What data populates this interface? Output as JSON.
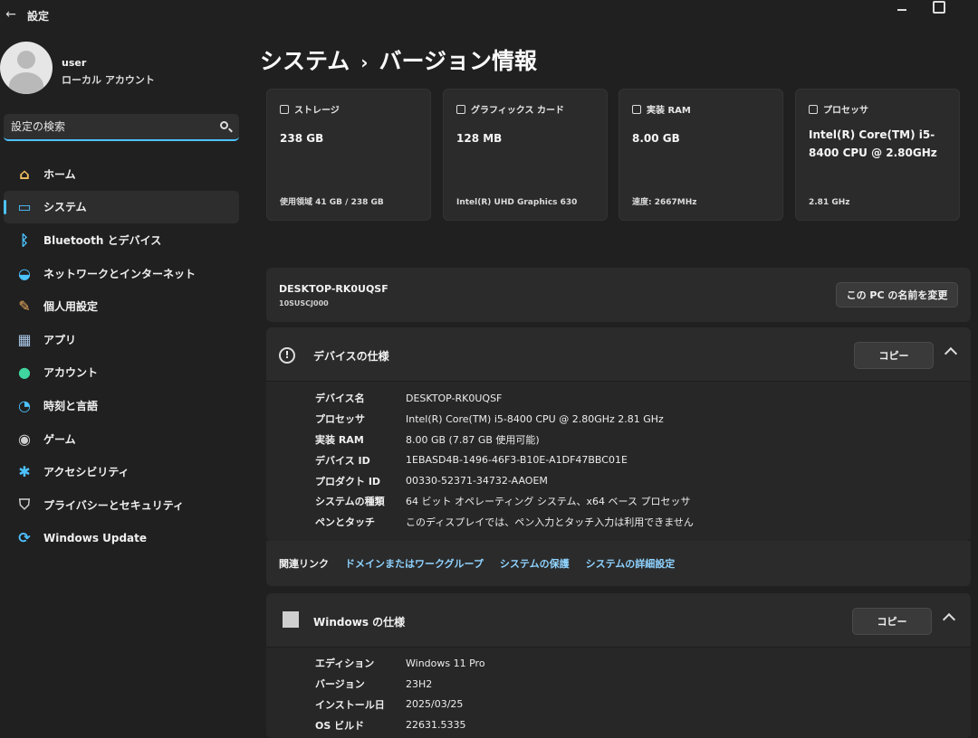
{
  "app": {
    "title": "設定",
    "back_glyph": "←"
  },
  "user": {
    "name": "user",
    "account_type": "ローカル アカウント"
  },
  "search": {
    "placeholder": "設定の検索"
  },
  "nav": {
    "items": [
      {
        "label": "ホーム",
        "icon": "home-icon",
        "glyph": "⌂",
        "color": "#f0c060"
      },
      {
        "label": "システム",
        "icon": "display-icon",
        "glyph": "▭",
        "color": "#4cc2ff",
        "active": true
      },
      {
        "label": "Bluetooth とデバイス",
        "icon": "bluetooth-icon",
        "glyph": "ᛒ",
        "color": "#4cc2ff"
      },
      {
        "label": "ネットワークとインターネット",
        "icon": "wifi-icon",
        "glyph": "◒",
        "color": "#4cc2ff"
      },
      {
        "label": "個人用設定",
        "icon": "brush-icon",
        "glyph": "✎",
        "color": "#f0b060"
      },
      {
        "label": "アプリ",
        "icon": "apps-icon",
        "glyph": "▦",
        "color": "#aac8e8"
      },
      {
        "label": "アカウント",
        "icon": "person-icon",
        "glyph": "●",
        "color": "#3fd6a0"
      },
      {
        "label": "時刻と言語",
        "icon": "globe-clock-icon",
        "glyph": "◔",
        "color": "#4cc2ff"
      },
      {
        "label": "ゲーム",
        "icon": "gamepad-icon",
        "glyph": "◉",
        "color": "#cfcfcf"
      },
      {
        "label": "アクセシビリティ",
        "icon": "accessibility-icon",
        "glyph": "✱",
        "color": "#4cc2ff"
      },
      {
        "label": "プライバシーとセキュリティ",
        "icon": "shield-icon",
        "glyph": "⛉",
        "color": "#cfcfcf"
      },
      {
        "label": "Windows Update",
        "icon": "update-icon",
        "glyph": "⟳",
        "color": "#4cc2ff"
      }
    ]
  },
  "page": {
    "section": "システム",
    "separator": "›",
    "title": "バージョン情報"
  },
  "cards": [
    {
      "label": "ストレージ",
      "value": "238 GB",
      "sub": "使用領域 41 GB / 238 GB",
      "icon": "storage-icon"
    },
    {
      "label": "グラフィックス カード",
      "value": "128 MB",
      "sub": "Intel(R) UHD Graphics 630",
      "icon": "gpu-icon"
    },
    {
      "label": "実装 RAM",
      "value": "8.00 GB",
      "sub": "速度: 2667MHz",
      "icon": "ram-icon"
    },
    {
      "label": "プロセッサ",
      "value": "Intel(R) Core(TM) i5-8400 CPU @ 2.80GHz",
      "sub": "2.81 GHz",
      "icon": "cpu-icon"
    }
  ],
  "pc": {
    "name": "DESKTOP-RK0UQSF",
    "model": "10SUSCJ000",
    "rename_label": "この PC の名前を変更"
  },
  "device_specs": {
    "title": "デバイスの仕様",
    "copy_label": "コピー",
    "rows": [
      {
        "key": "デバイス名",
        "value": "DESKTOP-RK0UQSF"
      },
      {
        "key": "プロセッサ",
        "value": "Intel(R) Core(TM) i5-8400 CPU @ 2.80GHz   2.81 GHz"
      },
      {
        "key": "実装 RAM",
        "value": "8.00 GB (7.87 GB 使用可能)"
      },
      {
        "key": "デバイス ID",
        "value": "1EBASD4B-1496-46F3-B10E-A1DF47BBC01E"
      },
      {
        "key": "プロダクト ID",
        "value": "00330-52371-34732-AAOEM"
      },
      {
        "key": "システムの種類",
        "value": "64 ビット オペレーティング システム、x64 ベース プロセッサ"
      },
      {
        "key": "ペンとタッチ",
        "value": "このディスプレイでは、ペン入力とタッチ入力は利用できません"
      }
    ]
  },
  "related": {
    "label": "関連リンク",
    "links": [
      "ドメインまたはワークグループ",
      "システムの保護",
      "システムの詳細設定"
    ]
  },
  "windows_specs": {
    "title": "Windows の仕様",
    "copy_label": "コピー",
    "rows": [
      {
        "key": "エディション",
        "value": "Windows 11 Pro"
      },
      {
        "key": "バージョン",
        "value": "23H2"
      },
      {
        "key": "インストール日",
        "value": "2025/03/25"
      },
      {
        "key": "OS ビルド",
        "value": "22631.5335"
      }
    ]
  }
}
